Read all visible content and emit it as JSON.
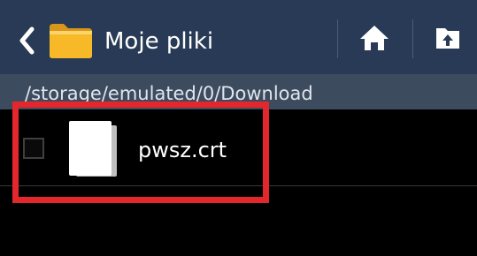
{
  "header": {
    "title": "Moje pliki",
    "folder_color": "#f7b928",
    "back_icon": "chevron-left-icon",
    "home_icon": "home-icon",
    "up_icon": "folder-up-icon"
  },
  "path": {
    "text": "/storage/emulated/0/Download"
  },
  "files": [
    {
      "name": "pwsz.crt",
      "checked": false,
      "icon": "document-icon"
    }
  ],
  "highlight": {
    "color": "#e3272d"
  }
}
